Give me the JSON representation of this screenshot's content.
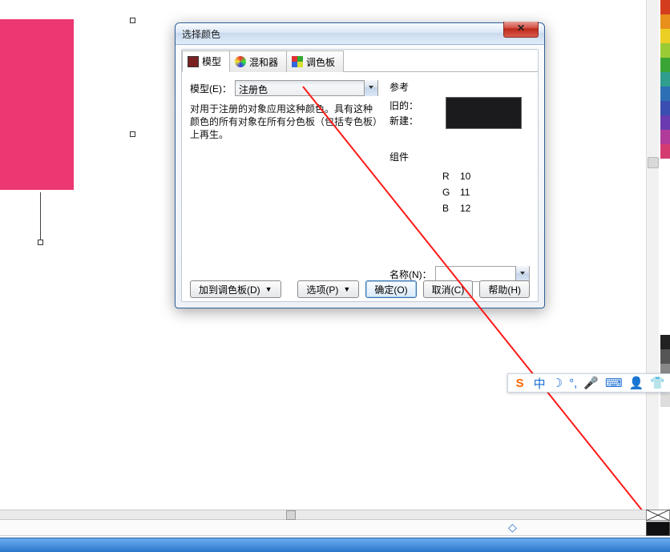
{
  "dialog": {
    "title": "选择颜色",
    "tabs": {
      "model": "模型",
      "mixer": "混和器",
      "palette": "调色板"
    },
    "model_label": "模型(E)：",
    "model_value": "注册色",
    "description": "对用于注册的对象应用这种颜色。具有这种颜色的所有对象在所有分色板（包括专色板）上再生。",
    "ref": {
      "title": "参考",
      "old_label": "旧的：",
      "new_label": "新建："
    },
    "components": {
      "title": "组件",
      "r_label": "R",
      "r": "10",
      "g_label": "G",
      "g": "11",
      "b_label": "B",
      "b": "12"
    },
    "name_label": "名称(N)：",
    "buttons": {
      "add_palette": "加到调色板(D)",
      "options": "选项(P)",
      "ok": "确定(O)",
      "cancel": "取消(C)",
      "help": "帮助(H)"
    }
  },
  "ime": {
    "logo": "S",
    "lang": "中"
  },
  "palette_colors": [
    "#d43c1e",
    "#e88f1c",
    "#eccf24",
    "#9acb34",
    "#3aa535",
    "#2f9e8e",
    "#2d6fb5",
    "#394eb0",
    "#6a3bb0",
    "#b03b9a",
    "#d43c71",
    "#222",
    "#777",
    "#ccc"
  ]
}
